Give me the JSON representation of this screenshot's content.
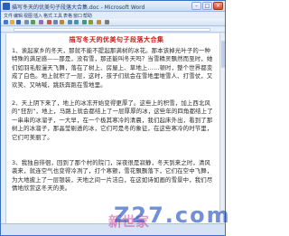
{
  "window": {
    "title": "描写冬天的优美句子段落大合集.doc - Microsoft Word"
  },
  "menu": {
    "items": [
      "文件",
      "编辑",
      "视图",
      "插入",
      "格式",
      "工具",
      "表格",
      "窗口",
      "帮助"
    ]
  },
  "document": {
    "heading": "描写冬天的优美句子段落大合集",
    "paragraphs": [
      "1、诶起家乡的冬天，那就不能不提起那满树的冰花。那本该掉光叶子的一种特殊的满足感——那是，没有雪，那还能叫冬天吗？当雪精灵飘然而至时，她们如羽毛般漫天飞舞，落在了树上、房屋上、草地上……顿时，整个世界都变成了白色。地上就积了一层，这时，孩子们就会在雪地里堆雪人、打雪仗，又欢笑、又呐喊，跳跃奔跑在雪地里。",
      "2、天上阴下来了，地上的冰冻开始变得更厚了。这些上的积雪，加上西北风的“狂刮”，地上，马路上就会都结上了一层厚厚的冰，这些年的四角都结上了一串串的冰溜子，一大早，在一个极其寒冷的清晨，我们起床外出，看到了那树上的冰溜子，那晶莹剔透的冰，它们可是冬的象征，在这些寒冷的时节里，它们可美丽了。",
      "3、我独自徘徊，回到了那个村的院门，深夜很是寂静，冬天到来之时，清风袭来，就连空气也变得冷冽了，打个寒颤，雪花飘飘落下，它们在空中飞舞，为大地披上了一层银装，天地之间一片洁白，在这如诗如画的雪景中，我们尽情地欣赏这冬天的美。"
    ]
  },
  "watermark": {
    "main": "Z27.com",
    "sub": "新世家"
  }
}
